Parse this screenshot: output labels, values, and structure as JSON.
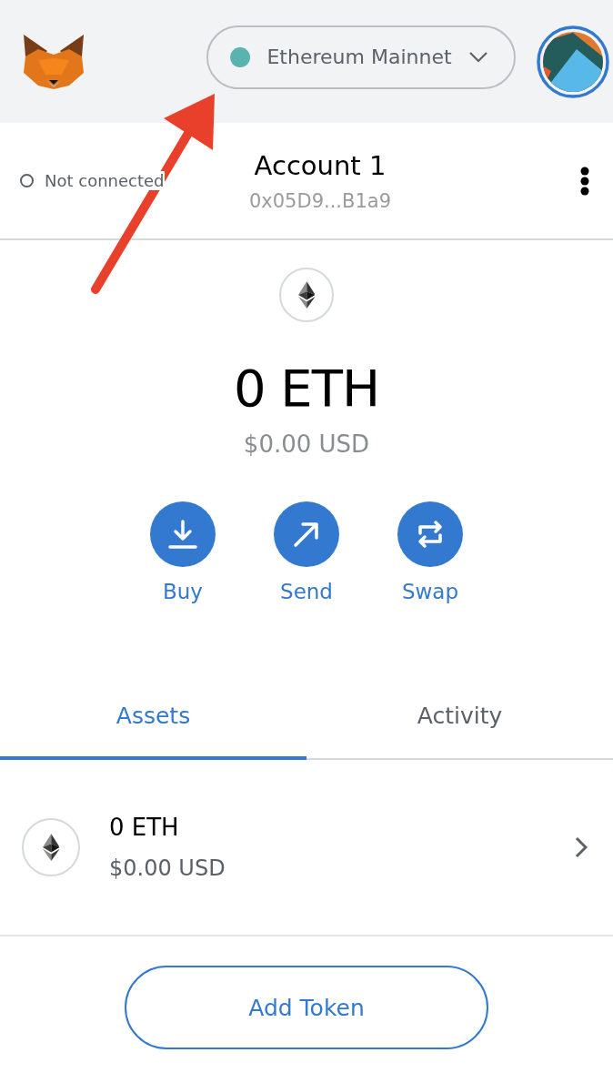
{
  "network": {
    "name": "Ethereum Mainnet"
  },
  "account": {
    "connection": "Not connected",
    "connected": false,
    "name": "Account 1",
    "address": "0x05D9...B1a9"
  },
  "balance": {
    "primary": "0 ETH",
    "secondary": "$0.00 USD"
  },
  "actions": [
    {
      "kind": "buy",
      "label": "Buy"
    },
    {
      "kind": "send",
      "label": "Send"
    },
    {
      "kind": "swap",
      "label": "Swap"
    }
  ],
  "tabs": [
    {
      "label": "Assets",
      "selected": true
    },
    {
      "label": "Activity",
      "selected": false
    }
  ],
  "assets": [
    {
      "amount": "0 ETH",
      "value": "$0.00 USD"
    }
  ],
  "add_token": "Add Token"
}
